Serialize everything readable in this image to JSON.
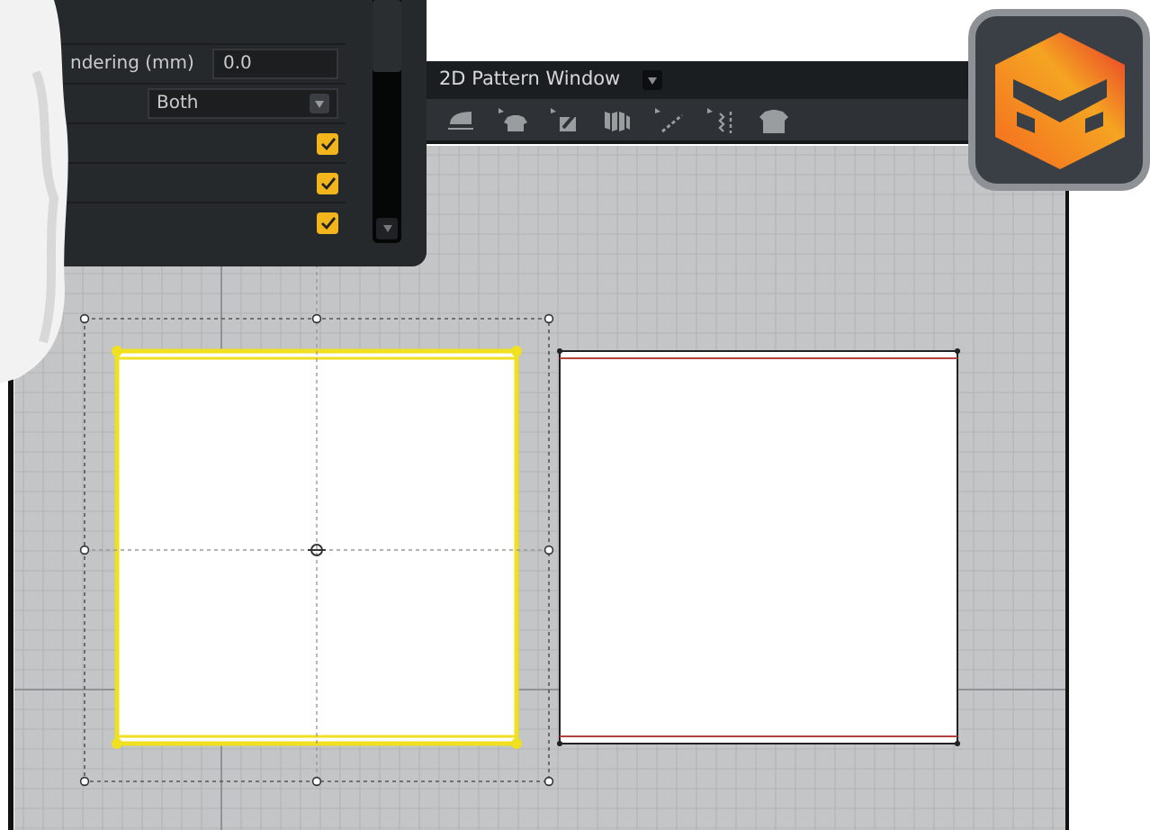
{
  "property_panel": {
    "rows": [
      {
        "kind": "field",
        "label": "ndering (mm)",
        "value": "0.0"
      },
      {
        "kind": "select",
        "value": "Both"
      },
      {
        "kind": "checkbox",
        "checked": true
      },
      {
        "kind": "checkbox",
        "checked": true
      },
      {
        "kind": "checkbox",
        "checked": true
      }
    ]
  },
  "pattern_window": {
    "title": "2D Pattern Window"
  },
  "patterns": [
    {
      "selected": true
    },
    {
      "selected": false
    }
  ]
}
